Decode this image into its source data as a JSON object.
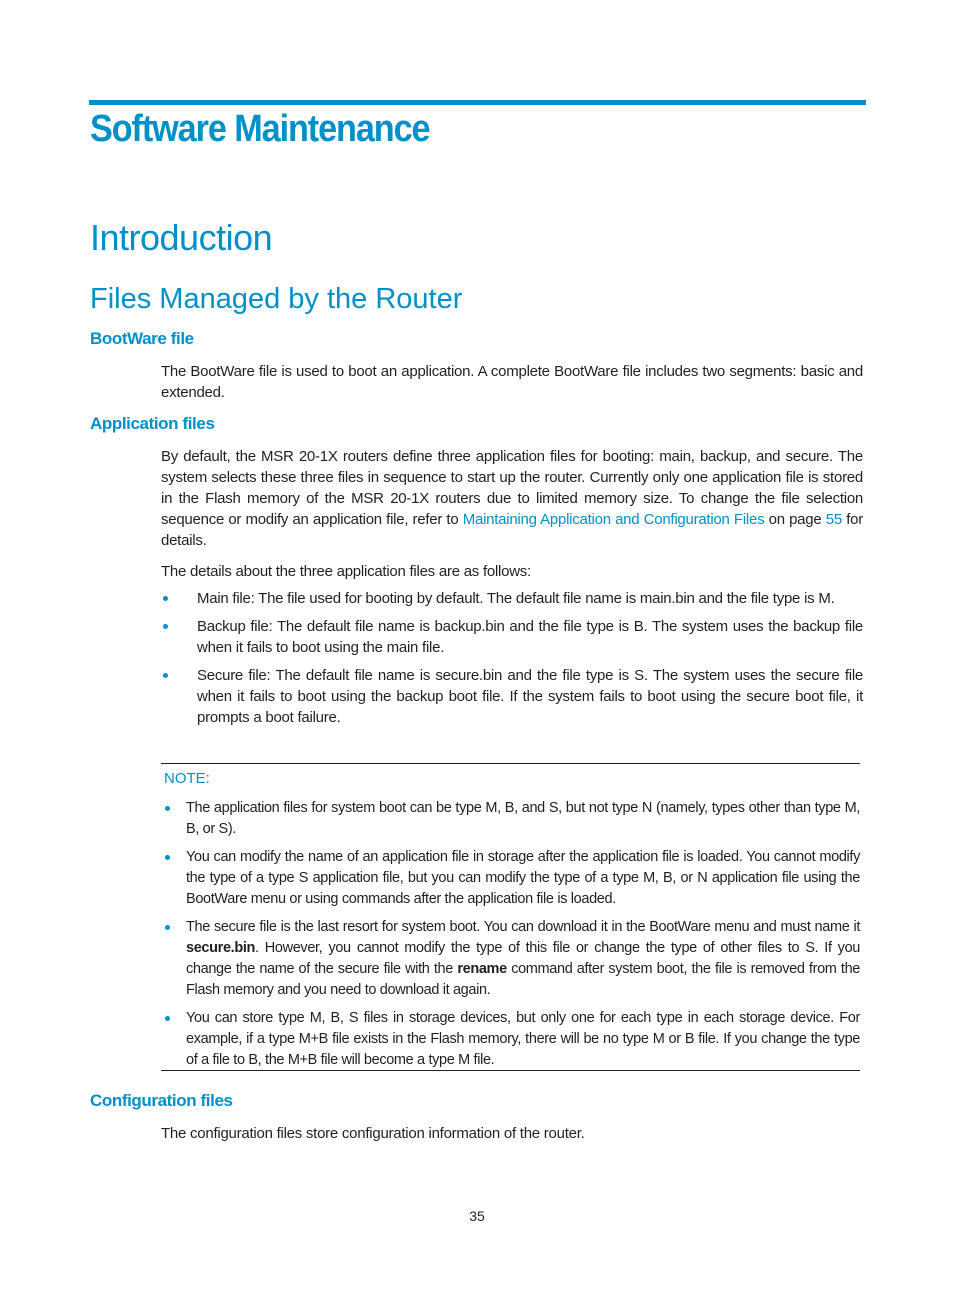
{
  "chapter_title": "Software Maintenance",
  "section_title": "Introduction",
  "subsection_title": "Files Managed by the Router",
  "bootware": {
    "heading": "BootWare file",
    "text": "The BootWare file is used to boot an application. A complete BootWare file includes two segments: basic and extended."
  },
  "application": {
    "heading": "Application files",
    "para_before_link": "By default, the MSR 20-1X routers define three application files for booting: main, backup, and secure. The system selects these three files in sequence to start up the router. Currently only one application file is stored in the Flash memory of the MSR 20-1X routers due to limited memory size. To change the file selection sequence or modify an application file, refer to ",
    "link_text": "Maintaining Application and Configuration Files",
    "para_mid": " on page ",
    "page_link": "55",
    "para_after": " for details.",
    "details_intro": "The details about the three application files are as follows:",
    "bullets": [
      "Main file: The file used for booting by default. The default file name is main.bin and the file type is M.",
      "Backup file: The default file name is backup.bin and the file type is B. The system uses the backup file when it fails to boot using the main file.",
      "Secure file: The default file name is secure.bin and the file type is S. The system uses the secure file when it fails to boot using the backup boot file. If the system fails to boot using the secure boot file, it prompts a boot failure."
    ]
  },
  "note": {
    "label": "NOTE:",
    "items": [
      {
        "text": "The application files for system boot can be type M, B, and S, but not type N (namely, types other than type M, B, or S)."
      },
      {
        "text": "You can modify the name of an application file in storage after the application file is loaded. You cannot modify the type of a type S application file, but you can modify the type of a type M, B, or N application file using the BootWare menu or using commands after the application file is loaded."
      },
      {
        "part1": "The secure file is the last resort for system boot. You can download it in the BootWare menu and must name it ",
        "bold1": "secure.bin",
        "part2": ". However, you cannot modify the type of this file or change the type of other files to S. If you change the name of the secure file with the ",
        "bold2": "rename",
        "part3": " command after system boot, the file is removed from the Flash memory and you need to download it again."
      },
      {
        "text": "You can store type M, B, S files in storage devices, but only one for each type in each storage device. For example, if a type M+B file exists in the Flash memory, there will be no type M or B file. If you change the type of a file to B, the M+B file will become a type M file."
      }
    ]
  },
  "configuration": {
    "heading": "Configuration files",
    "text": "The configuration files store configuration information of the router."
  },
  "page_number": "35",
  "colors": {
    "accent": "#0090c8",
    "text": "#231f20"
  }
}
